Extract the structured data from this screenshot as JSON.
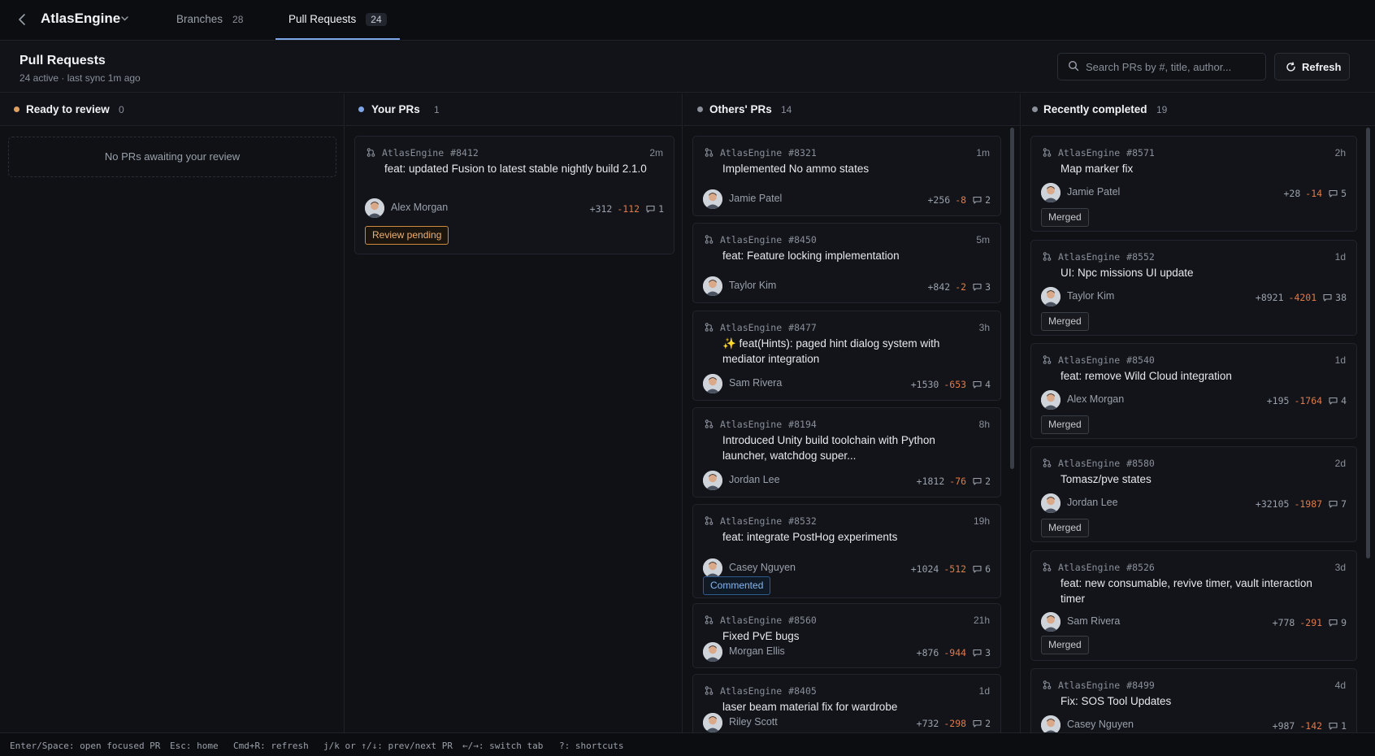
{
  "app": {
    "name": "AtlasEngine"
  },
  "tabs": [
    {
      "label": "Branches",
      "count": "28"
    },
    {
      "label": "Pull Requests",
      "count": "24"
    }
  ],
  "header": {
    "title": "Pull Requests",
    "subtitle": "24 active · last sync 1m ago",
    "search_placeholder": "Search PRs by #, title, author...",
    "refresh_label": "Refresh"
  },
  "columns": {
    "ready": {
      "title": "Ready to review",
      "count": "0",
      "empty_text": "No PRs awaiting your review",
      "dot": "#e0a060"
    },
    "yours": {
      "title": "Your PRs",
      "count": "1",
      "dot": "#7da6e8"
    },
    "others": {
      "title": "Others' PRs",
      "count": "14",
      "dot": "#8a8f99"
    },
    "completed": {
      "title": "Recently completed",
      "count": "19",
      "dot": "#8a8f99"
    }
  },
  "your_prs": [
    {
      "repo": "AtlasEngine",
      "number": "#8412",
      "age": "2m",
      "title": "feat: updated Fusion to latest stable nightly build 2.1.0",
      "author": "Alex Morgan",
      "additions": "+312",
      "deletions": "-112",
      "comments": "1",
      "badge": "Review pending"
    }
  ],
  "others_prs": [
    {
      "repo": "AtlasEngine",
      "number": "#8321",
      "age": "1m",
      "title": "Implemented No ammo states",
      "author": "Jamie Patel",
      "additions": "+256",
      "deletions": "-8",
      "comments": "2"
    },
    {
      "repo": "AtlasEngine",
      "number": "#8450",
      "age": "5m",
      "title": "feat: Feature locking implementation",
      "author": "Taylor Kim",
      "additions": "+842",
      "deletions": "-2",
      "comments": "3"
    },
    {
      "repo": "AtlasEngine",
      "number": "#8477",
      "age": "3h",
      "title": "✨ feat(Hints): paged hint dialog system with mediator integration",
      "author": "Sam Rivera",
      "additions": "+1530",
      "deletions": "-653",
      "comments": "4"
    },
    {
      "repo": "AtlasEngine",
      "number": "#8194",
      "age": "8h",
      "title": "Introduced Unity build toolchain with Python launcher, watchdog super...",
      "author": "Jordan Lee",
      "additions": "+1812",
      "deletions": "-76",
      "comments": "2"
    },
    {
      "repo": "AtlasEngine",
      "number": "#8532",
      "age": "19h",
      "title": "feat: integrate PostHog experiments",
      "author": "Casey Nguyen",
      "additions": "+1024",
      "deletions": "-512",
      "comments": "6",
      "badge": "Commented"
    },
    {
      "repo": "AtlasEngine",
      "number": "#8560",
      "age": "21h",
      "title": "Fixed PvE bugs",
      "author": "Morgan Ellis",
      "additions": "+876",
      "deletions": "-944",
      "comments": "3"
    },
    {
      "repo": "AtlasEngine",
      "number": "#8405",
      "age": "1d",
      "title": "laser beam material fix for wardrobe",
      "author": "Riley Scott",
      "additions": "+732",
      "deletions": "-298",
      "comments": "2"
    }
  ],
  "completed_prs": [
    {
      "repo": "AtlasEngine",
      "number": "#8571",
      "age": "2h",
      "title": "Map marker fix",
      "author": "Jamie Patel",
      "additions": "+28",
      "deletions": "-14",
      "comments": "5",
      "badge": "Merged"
    },
    {
      "repo": "AtlasEngine",
      "number": "#8552",
      "age": "1d",
      "title": "UI: Npc missions UI update",
      "author": "Taylor Kim",
      "additions": "+8921",
      "deletions": "-4201",
      "comments": "38",
      "badge": "Merged"
    },
    {
      "repo": "AtlasEngine",
      "number": "#8540",
      "age": "1d",
      "title": "feat: remove Wild Cloud integration",
      "author": "Alex Morgan",
      "additions": "+195",
      "deletions": "-1764",
      "comments": "4",
      "badge": "Merged"
    },
    {
      "repo": "AtlasEngine",
      "number": "#8580",
      "age": "2d",
      "title": "Tomasz/pve states",
      "author": "Jordan Lee",
      "additions": "+32105",
      "deletions": "-1987",
      "comments": "7",
      "badge": "Merged"
    },
    {
      "repo": "AtlasEngine",
      "number": "#8526",
      "age": "3d",
      "title": "feat: new consumable, revive timer, vault interaction timer",
      "author": "Sam Rivera",
      "additions": "+778",
      "deletions": "-291",
      "comments": "9",
      "badge": "Merged"
    },
    {
      "repo": "AtlasEngine",
      "number": "#8499",
      "age": "4d",
      "title": "Fix: SOS Tool Updates",
      "author": "Casey Nguyen",
      "additions": "+987",
      "deletions": "-142",
      "comments": "1",
      "badge": "Merged"
    }
  ],
  "footer": [
    "Enter/Space: open focused PR",
    "Esc: home",
    "Cmd+R: refresh",
    "j/k or ↑/↓: prev/next PR",
    "←/→: switch tab",
    "?: shortcuts"
  ]
}
